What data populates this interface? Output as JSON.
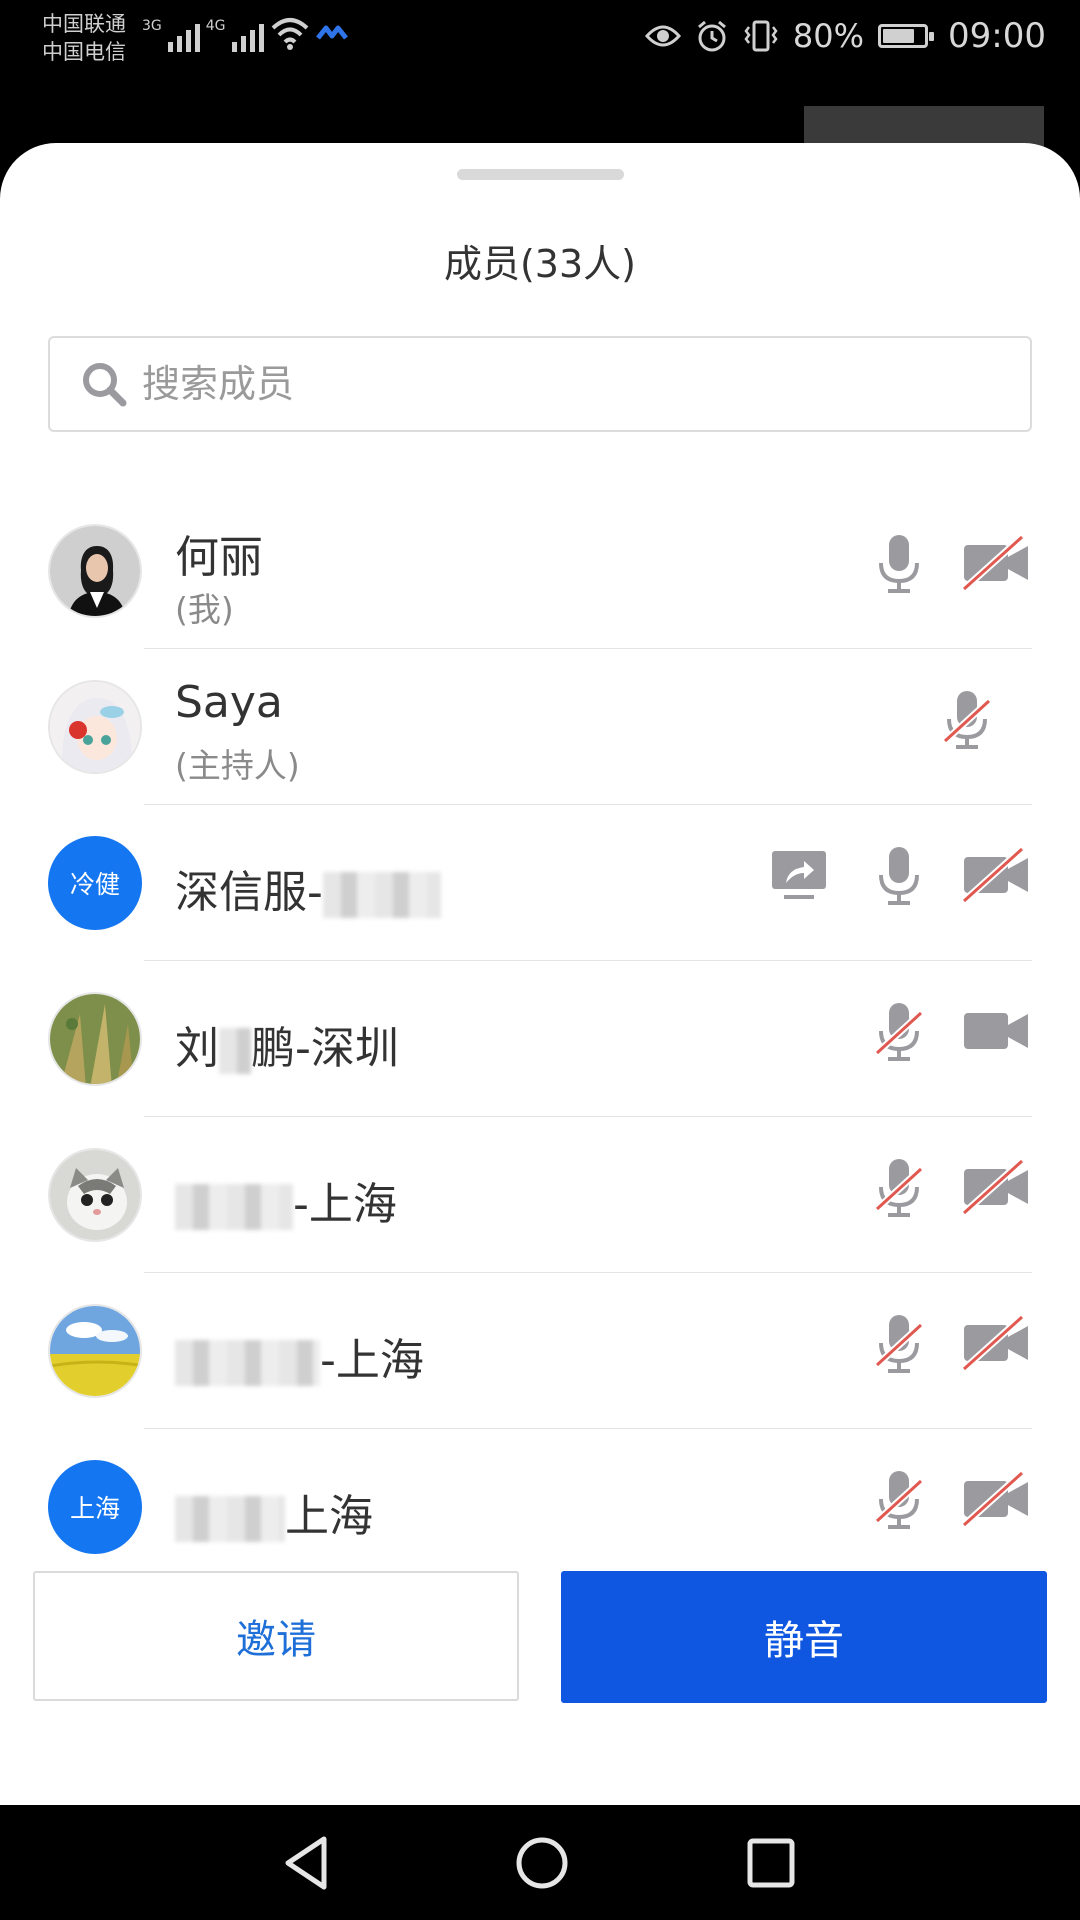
{
  "status_bar": {
    "carrier_1": "中国联通",
    "carrier_2": "中国电信",
    "net_1": "3G",
    "net_2": "4G",
    "battery_percent": "80%",
    "battery_level": 0.8,
    "time": "09:00",
    "icons": [
      "signal-icon",
      "wifi-icon",
      "app-notification-icon",
      "eye-icon",
      "alarm-icon",
      "vibrate-icon",
      "battery-icon"
    ]
  },
  "sheet": {
    "title": "成员(33人)",
    "search": {
      "placeholder": "搜索成员",
      "value": ""
    }
  },
  "members": [
    {
      "name": "何丽",
      "role": "(我)",
      "avatar": "photo",
      "share_screen": false,
      "mic": "on",
      "camera": "off"
    },
    {
      "name": "Saya",
      "role": "(主持人)",
      "avatar": "photo",
      "share_screen": false,
      "mic": "off",
      "camera": "none"
    },
    {
      "name": "深信服-",
      "avatar_text": "冷健",
      "avatar": "blue",
      "share_screen": true,
      "mic": "on",
      "camera": "off"
    },
    {
      "name_prefix": "刘",
      "name": "鹏-深圳",
      "avatar": "photo",
      "share_screen": false,
      "mic": "off",
      "camera": "on"
    },
    {
      "name": "-上海",
      "avatar": "photo",
      "share_screen": false,
      "mic": "off",
      "camera": "off"
    },
    {
      "name": "-上海",
      "avatar": "photo",
      "share_screen": false,
      "mic": "off",
      "camera": "off"
    },
    {
      "name": "上海",
      "avatar_text": "上海",
      "avatar": "blue",
      "share_screen": false,
      "mic": "off",
      "camera": "off"
    }
  ],
  "actions": {
    "invite": "邀请",
    "mute": "静音"
  },
  "colors": {
    "accent": "#0f56e0",
    "avatar_blue": "#1576f1",
    "icon_gray": "#9a9a9f",
    "muted_red": "#e0584f"
  }
}
